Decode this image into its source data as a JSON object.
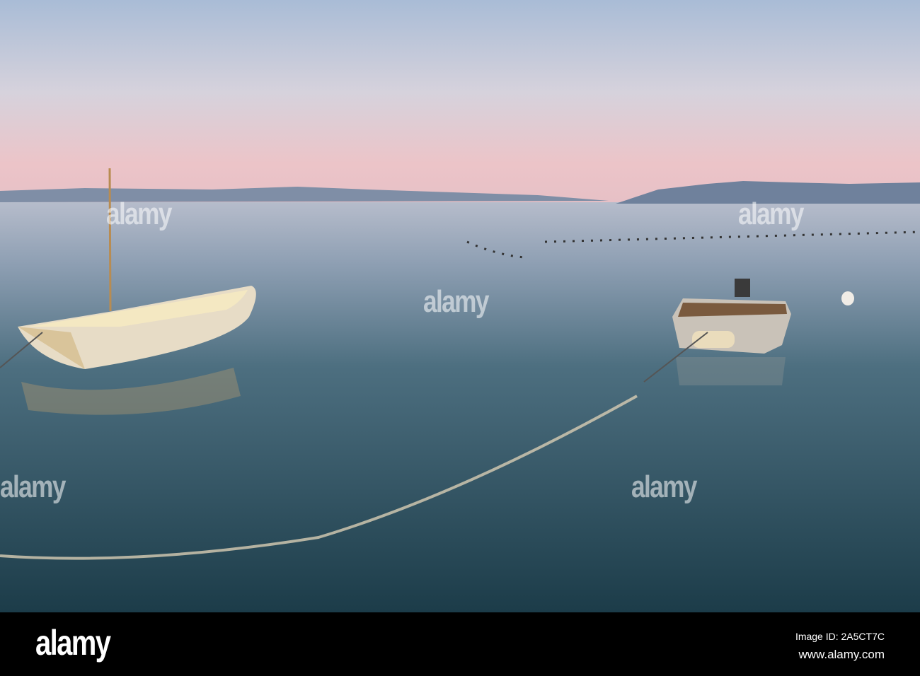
{
  "watermark": {
    "text": "alamy"
  },
  "footer": {
    "logo": "alamy",
    "image_id": "Image ID: 2A5CT7C",
    "url": "www.alamy.com"
  },
  "colors": {
    "sky_top": "#aebfd8",
    "sky_pink": "#e9c3c8",
    "water_far": "#a9b3c6",
    "water_near": "#1f4452"
  }
}
